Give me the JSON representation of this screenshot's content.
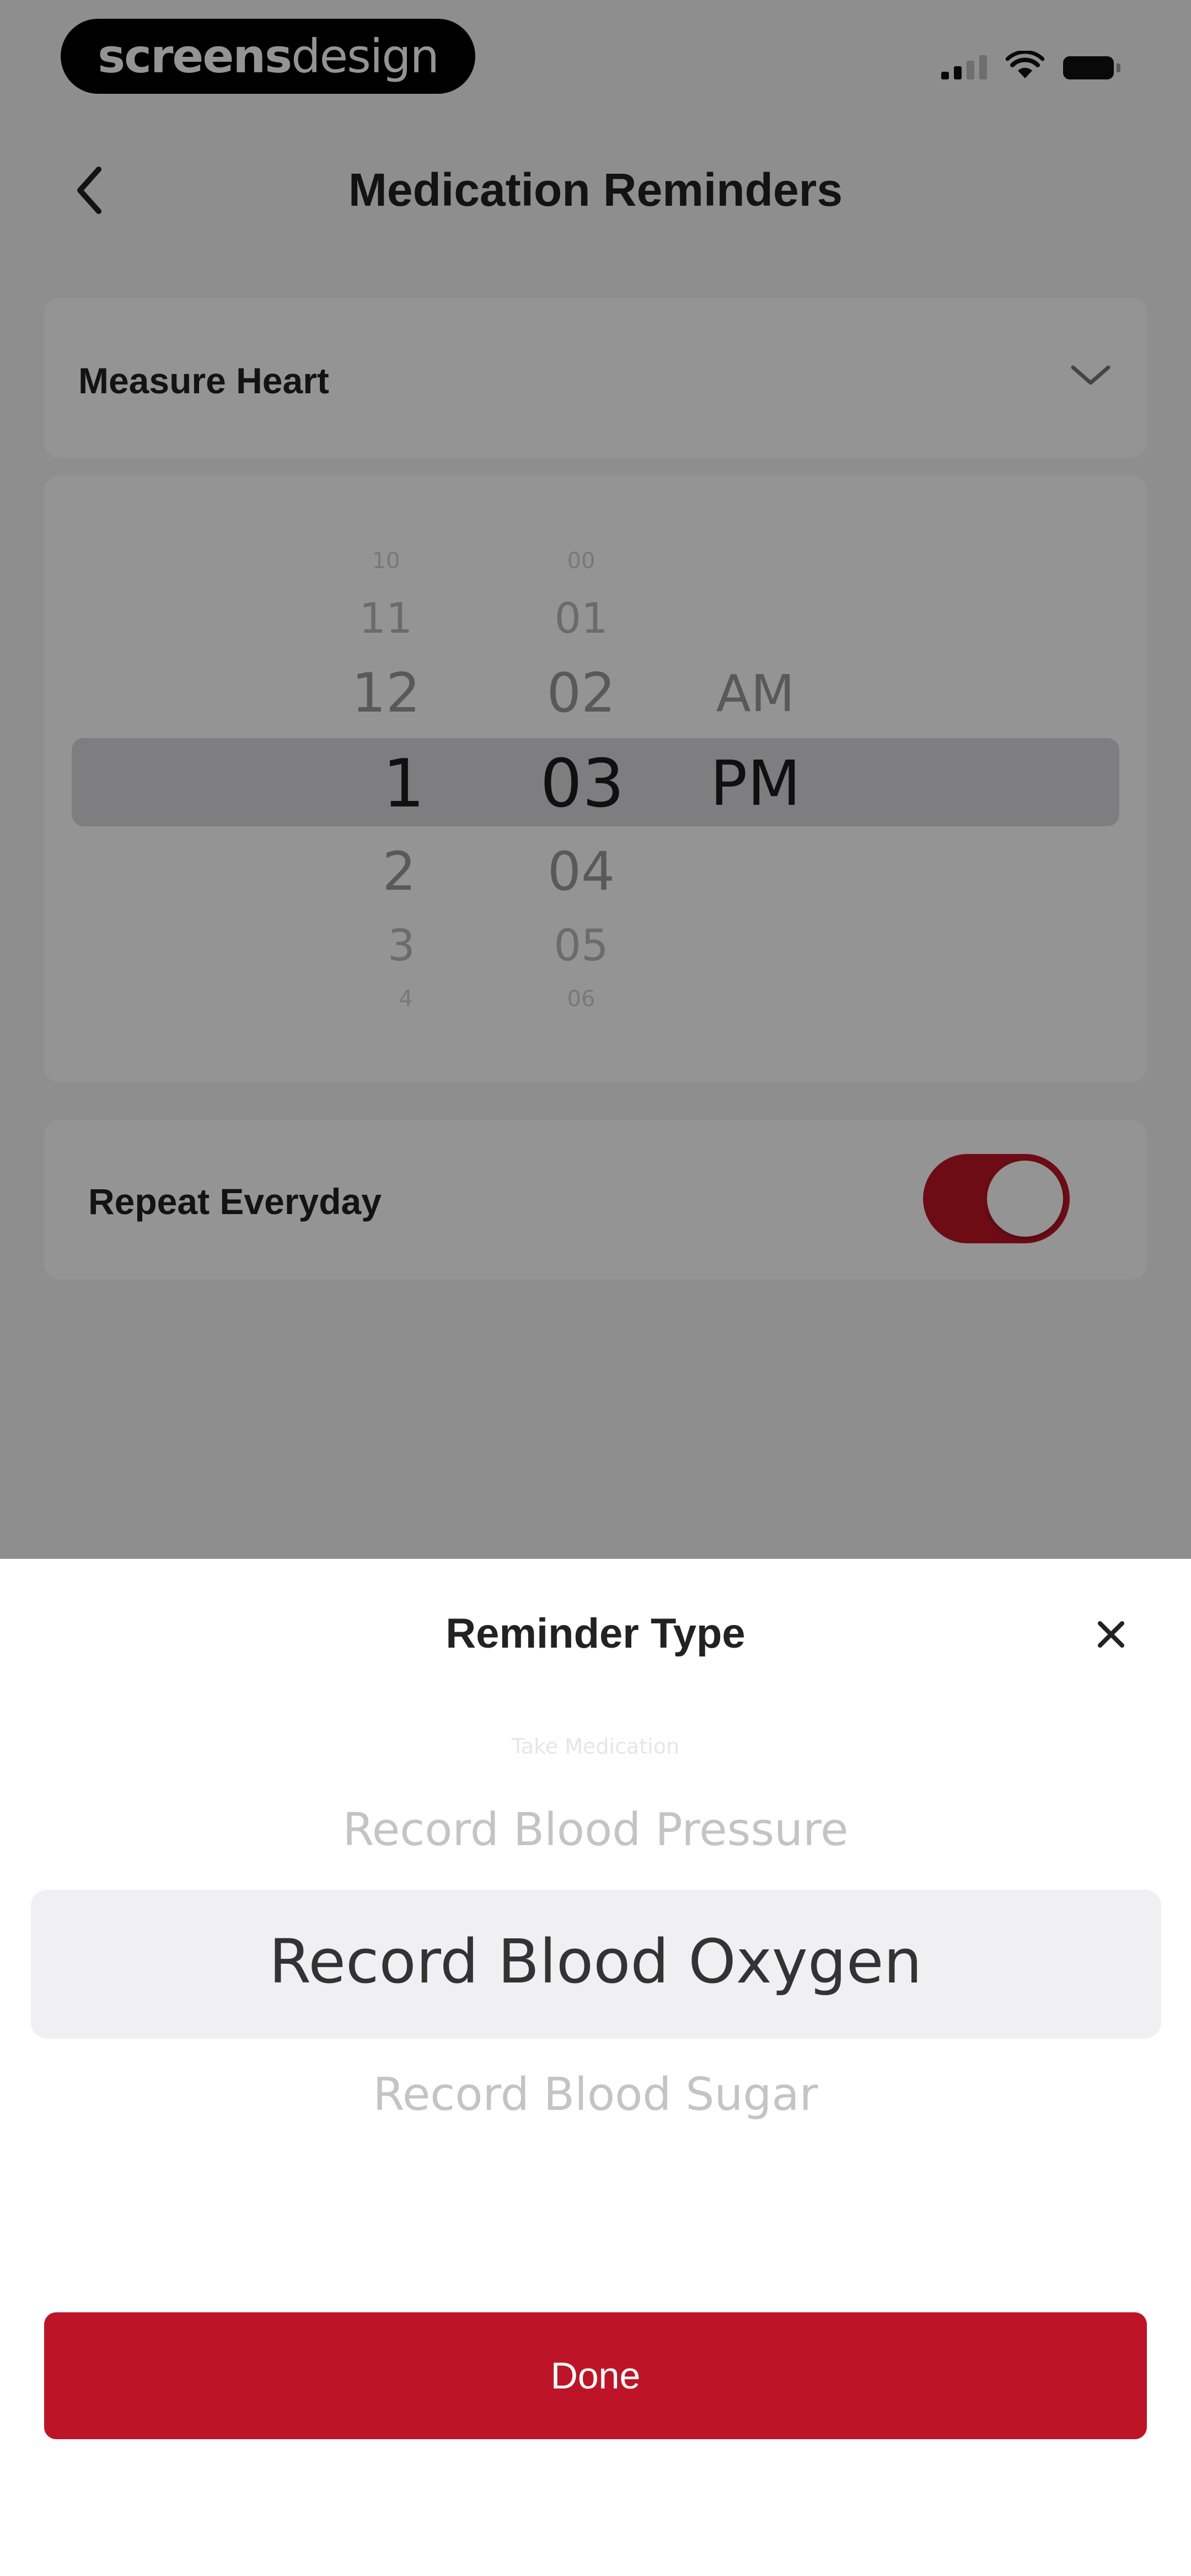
{
  "status_bar": {
    "brand_bold": "screens",
    "brand_light": "design"
  },
  "header": {
    "title": "Medication Reminders"
  },
  "reminder_select": {
    "value": "Measure Heart"
  },
  "time_picker": {
    "hours": [
      "10",
      "11",
      "12",
      "1",
      "2",
      "3",
      "4"
    ],
    "minutes": [
      "00",
      "01",
      "02",
      "03",
      "04",
      "05",
      "06"
    ],
    "periods": [
      "AM",
      "PM"
    ],
    "selected": {
      "hour": "1",
      "minute": "03",
      "period": "PM"
    }
  },
  "repeat": {
    "label": "Repeat Everyday",
    "enabled": true
  },
  "sheet": {
    "title": "Reminder Type",
    "options": [
      "Take Medication",
      "Record Blood Pressure",
      "Record Blood Oxygen",
      "Record Blood Sugar"
    ],
    "selected": "Record Blood Oxygen",
    "done_label": "Done"
  },
  "colors": {
    "accent": "#bd1527",
    "overlay": "rgba(0,0,0,0.42)",
    "text_primary": "#222222",
    "text_muted": "#c4c4c4"
  }
}
